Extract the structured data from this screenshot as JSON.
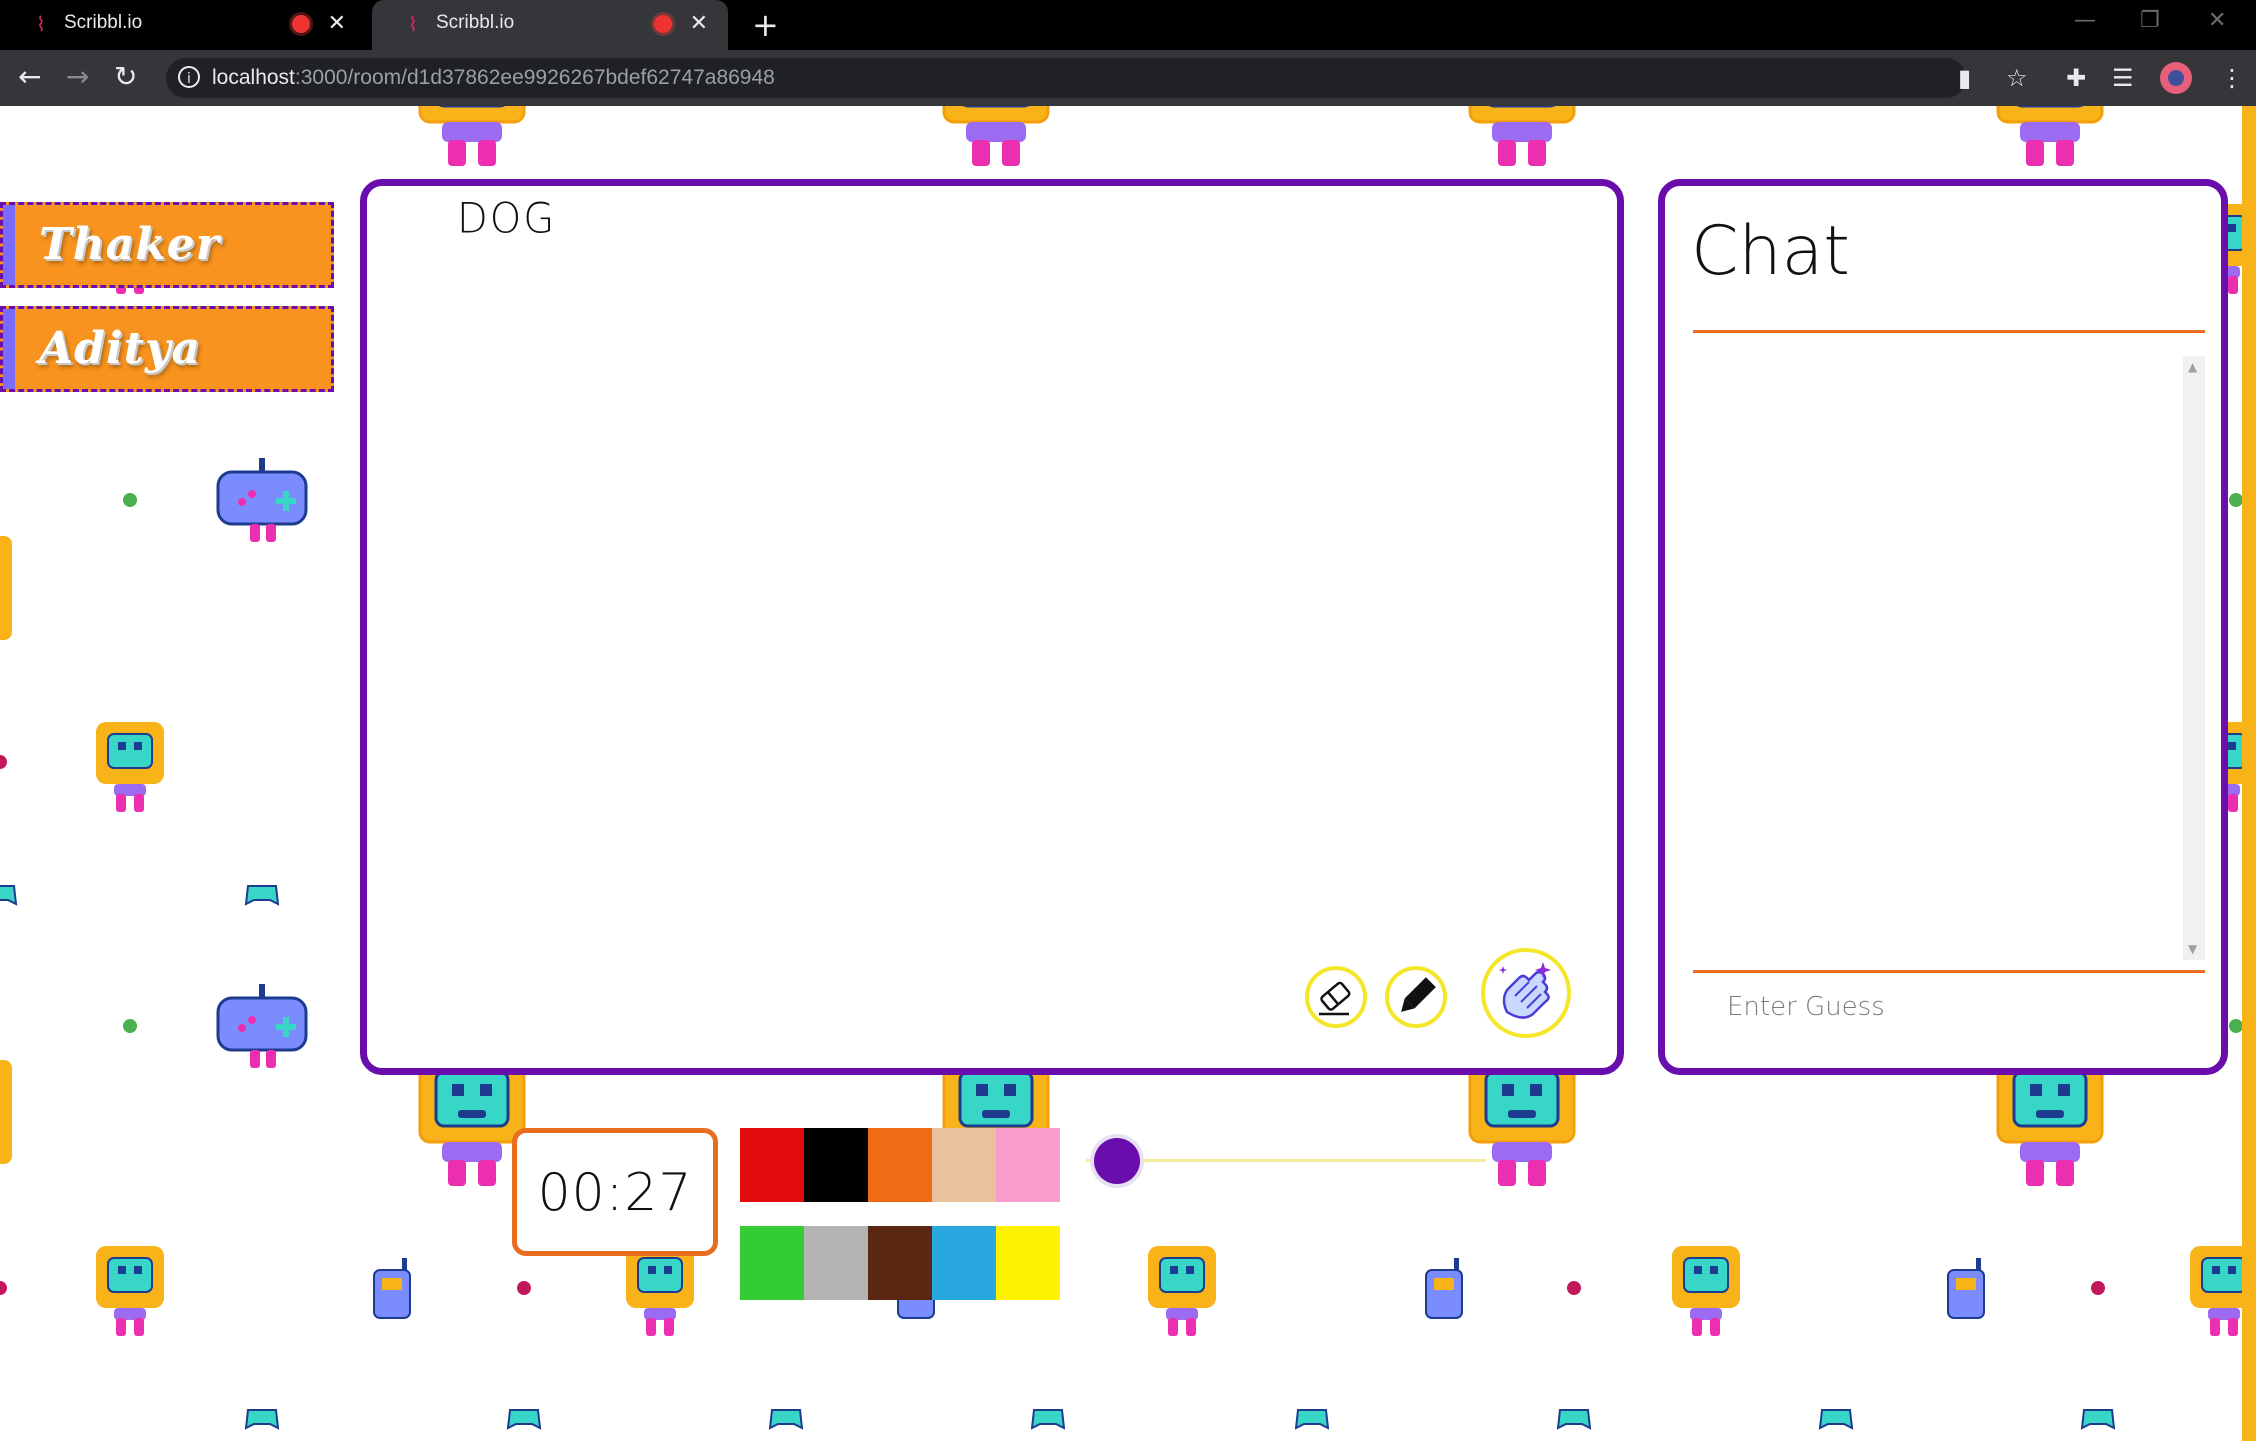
{
  "browser": {
    "tabs": [
      {
        "title": "Scribbl.io",
        "active": false
      },
      {
        "title": "Scribbl.io",
        "active": true
      }
    ],
    "url_host": "localhost",
    "url_path": ":3000/room/d1d37862ee9926267bdef62747a86948"
  },
  "players": [
    {
      "name": "Thaker"
    },
    {
      "name": "Aditya"
    }
  ],
  "board": {
    "word": "DOG",
    "tools": [
      "eraser-icon",
      "pencil-icon",
      "clear-canvas-icon"
    ]
  },
  "chat": {
    "title": "Chat",
    "input_placeholder": "Enter Guess",
    "messages": []
  },
  "timer": {
    "value": "00:27"
  },
  "palette": {
    "row1": [
      "#e30d0d",
      "#000000",
      "#ef6b16",
      "#e9c29b",
      "#f79ccb"
    ],
    "row2": [
      "#33cc33",
      "#b3b3b3",
      "#5b2713",
      "#29a8e0",
      "#fff200"
    ]
  },
  "brush": {
    "size_level": 0
  },
  "colors": {
    "accent_purple": "#6a0dad",
    "accent_orange": "#e96d1f",
    "player_bg": "#f7931e"
  }
}
